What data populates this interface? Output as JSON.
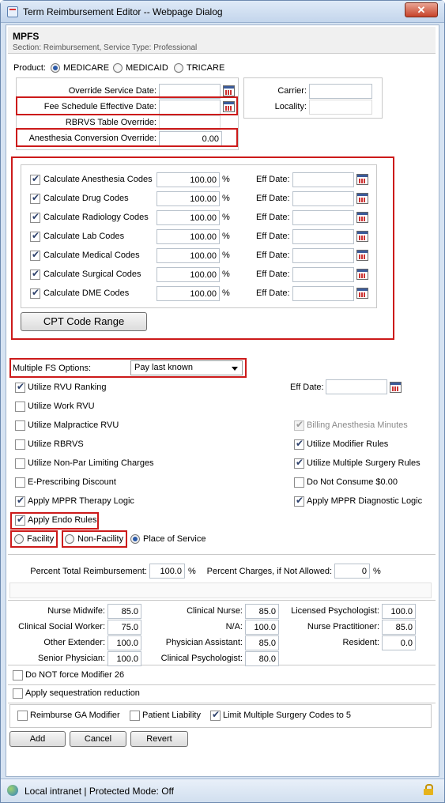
{
  "window": {
    "title": "Term Reimbursement Editor -- Webpage Dialog",
    "close": "✕"
  },
  "header": {
    "title": "MPFS",
    "subtitle": "Section: Reimbursement, Service Type: Professional"
  },
  "product": {
    "label": "Product:",
    "options": [
      {
        "label": "MEDICARE",
        "selected": true
      },
      {
        "label": "MEDICAID",
        "selected": false
      },
      {
        "label": "TRICARE",
        "selected": false
      }
    ]
  },
  "dates": {
    "override_service_date": {
      "label": "Override Service Date:",
      "value": ""
    },
    "fee_schedule_effective_date": {
      "label": "Fee Schedule Effective Date:",
      "value": ""
    },
    "rbrvs_table_override": {
      "label": "RBRVS Table Override:",
      "value": ""
    },
    "anesthesia_conversion_override": {
      "label": "Anesthesia Conversion Override:",
      "value": "0.00"
    },
    "carrier": {
      "label": "Carrier:",
      "value": ""
    },
    "locality": {
      "label": "Locality:",
      "value": ""
    }
  },
  "calc_codes": [
    {
      "label": "Calculate Anesthesia Codes",
      "checked": true,
      "percent": "100.00",
      "unit": "%",
      "eff_label": "Eff Date:",
      "eff_value": ""
    },
    {
      "label": "Calculate Drug Codes",
      "checked": true,
      "percent": "100.00",
      "unit": "%",
      "eff_label": "Eff Date:",
      "eff_value": ""
    },
    {
      "label": "Calculate Radiology Codes",
      "checked": true,
      "percent": "100.00",
      "unit": "%",
      "eff_label": "Eff Date:",
      "eff_value": ""
    },
    {
      "label": "Calculate Lab Codes",
      "checked": true,
      "percent": "100.00",
      "unit": "%",
      "eff_label": "Eff Date:",
      "eff_value": ""
    },
    {
      "label": "Calculate Medical Codes",
      "checked": true,
      "percent": "100.00",
      "unit": "%",
      "eff_label": "Eff Date:",
      "eff_value": ""
    },
    {
      "label": "Calculate Surgical Codes",
      "checked": true,
      "percent": "100.00",
      "unit": "%",
      "eff_label": "Eff Date:",
      "eff_value": ""
    },
    {
      "label": "Calculate DME Codes",
      "checked": true,
      "percent": "100.00",
      "unit": "%",
      "eff_label": "Eff Date:",
      "eff_value": ""
    }
  ],
  "cpt_button": "CPT Code Range",
  "multiple_fs": {
    "label": "Multiple FS Options:",
    "value": "Pay last known"
  },
  "options_left": [
    {
      "label": "Utilize RVU Ranking",
      "checked": true
    },
    {
      "label": "Utilize Work RVU",
      "checked": false
    },
    {
      "label": "Utilize Malpractice RVU",
      "checked": false
    },
    {
      "label": "Utilize RBRVS",
      "checked": false
    },
    {
      "label": "Utilize Non-Par Limiting Charges",
      "checked": false
    },
    {
      "label": "E-Prescribing Discount",
      "checked": false
    },
    {
      "label": "Apply MPPR Therapy Logic",
      "checked": true
    },
    {
      "label": "Apply Endo Rules",
      "checked": true
    }
  ],
  "eff_date_label": "Eff Date:",
  "options_right": [
    {
      "label": "Billing Anesthesia Minutes",
      "checked": true,
      "disabled": true
    },
    {
      "label": "Utilize Modifier Rules",
      "checked": true,
      "disabled": false
    },
    {
      "label": "Utilize Multiple Surgery Rules",
      "checked": true,
      "disabled": false
    },
    {
      "label": "Do Not Consume $0.00",
      "checked": false,
      "disabled": false
    },
    {
      "label": "Apply MPPR Diagnostic Logic",
      "checked": true,
      "disabled": false
    }
  ],
  "place": {
    "options": [
      {
        "label": "Facility",
        "selected": false
      },
      {
        "label": "Non-Facility",
        "selected": false
      },
      {
        "label": "Place of Service",
        "selected": true
      }
    ]
  },
  "percent_total": {
    "label": "Percent Total Reimbursement:",
    "value": "100.0",
    "unit": "%"
  },
  "percent_charges": {
    "label": "Percent Charges, if Not Allowed:",
    "value": "0",
    "unit": "%"
  },
  "providers": [
    [
      {
        "label": "Nurse Midwife:",
        "value": "85.0"
      },
      {
        "label": "Clinical Nurse:",
        "value": "85.0"
      },
      {
        "label": "Licensed Psychologist:",
        "value": "100.0"
      }
    ],
    [
      {
        "label": "Clinical Social Worker:",
        "value": "75.0"
      },
      {
        "label": "N/A:",
        "value": "100.0"
      },
      {
        "label": "Nurse Practitioner:",
        "value": "85.0"
      }
    ],
    [
      {
        "label": "Other Extender:",
        "value": "100.0"
      },
      {
        "label": "Physician Assistant:",
        "value": "85.0"
      },
      {
        "label": "Resident:",
        "value": "0.0"
      }
    ],
    [
      {
        "label": "Senior Physician:",
        "value": "100.0"
      },
      {
        "label": "Clinical Psychologist:",
        "value": "80.0"
      },
      {
        "label": "",
        "value": ""
      }
    ]
  ],
  "bottom_checks": {
    "modifier26": {
      "label": "Do NOT force Modifier 26",
      "checked": false
    },
    "sequestration": {
      "label": "Apply sequestration reduction",
      "checked": false
    },
    "ga_modifier": {
      "label": "Reimburse GA Modifier",
      "checked": false
    },
    "patient_liability": {
      "label": "Patient Liability",
      "checked": false
    },
    "limit_surgery": {
      "label": "Limit Multiple Surgery Codes to 5",
      "checked": true
    }
  },
  "actions": {
    "add": "Add",
    "cancel": "Cancel",
    "revert": "Revert"
  },
  "status": {
    "text": "Local intranet | Protected Mode: Off"
  }
}
